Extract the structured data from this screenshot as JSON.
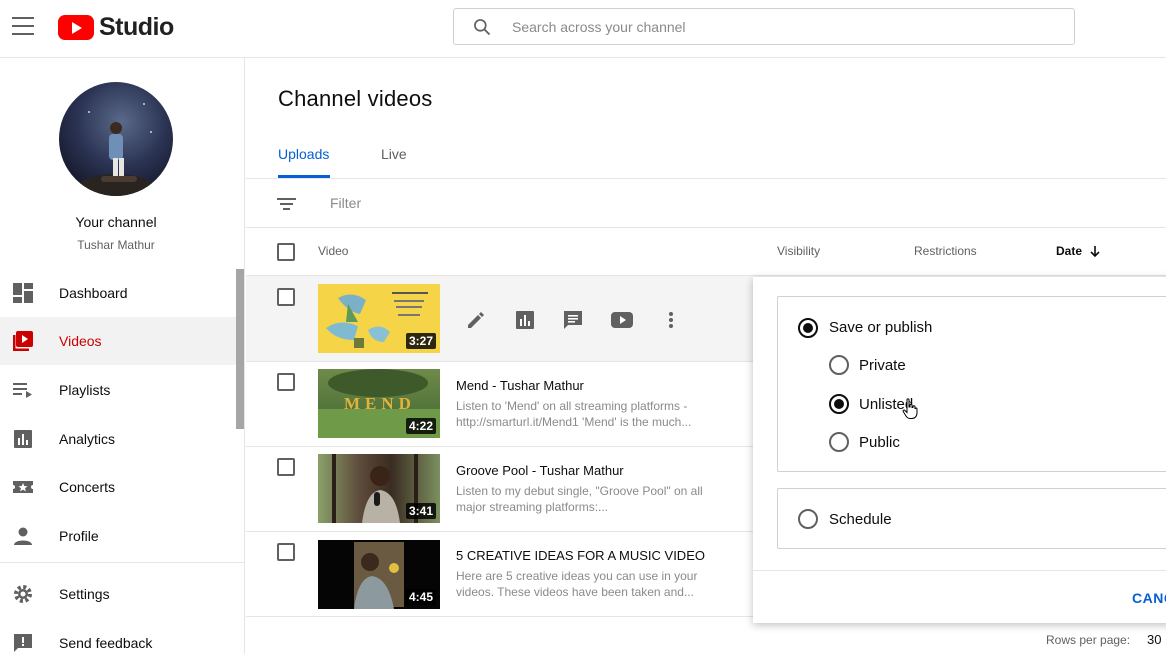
{
  "header": {
    "logo_text": "Studio",
    "search_placeholder": "Search across your channel"
  },
  "sidebar": {
    "channel_title": "Your channel",
    "channel_name": "Tushar Mathur",
    "items": [
      {
        "label": "Dashboard",
        "icon": "dashboard-icon"
      },
      {
        "label": "Videos",
        "icon": "videos-icon",
        "active": true
      },
      {
        "label": "Playlists",
        "icon": "playlists-icon"
      },
      {
        "label": "Analytics",
        "icon": "analytics-icon"
      },
      {
        "label": "Concerts",
        "icon": "concerts-icon"
      },
      {
        "label": "Profile",
        "icon": "profile-icon"
      },
      {
        "label": "Settings",
        "icon": "settings-icon"
      },
      {
        "label": "Send feedback",
        "icon": "feedback-icon"
      }
    ]
  },
  "main": {
    "title": "Channel videos",
    "tabs": [
      {
        "label": "Uploads",
        "active": true
      },
      {
        "label": "Live"
      }
    ],
    "filter_placeholder": "Filter",
    "columns": {
      "video": "Video",
      "visibility": "Visibility",
      "restrictions": "Restrictions",
      "date": "Date"
    },
    "videos": [
      {
        "title": "",
        "description": "",
        "duration": "3:27"
      },
      {
        "title": "Mend - Tushar Mathur",
        "description_line1": "Listen to 'Mend' on all streaming platforms -",
        "description_line2": "http://smarturl.it/Mend1 'Mend' is the much...",
        "duration": "4:22",
        "thumb_text": "MEND"
      },
      {
        "title": "Groove Pool - Tushar Mathur",
        "description_line1": "Listen to my debut single, \"Groove Pool\" on all",
        "description_line2": "major streaming platforms:...",
        "duration": "3:41"
      },
      {
        "title": "5 CREATIVE IDEAS FOR A MUSIC VIDEO",
        "description_line1": "Here are 5 creative ideas you can use in your",
        "description_line2": "videos. These videos have been taken and...",
        "duration": "4:45"
      }
    ]
  },
  "visibility_popup": {
    "save_or_publish": "Save or publish",
    "options": [
      "Private",
      "Unlisted",
      "Public"
    ],
    "selected": "Unlisted",
    "schedule": "Schedule",
    "cancel_label": "CANC"
  },
  "footer": {
    "rows_per_page_label": "Rows per page:",
    "rows_per_page_value": "30"
  },
  "colors": {
    "brand_red": "#ff0000",
    "active_red": "#cc0000",
    "link_blue": "#065fd4"
  }
}
